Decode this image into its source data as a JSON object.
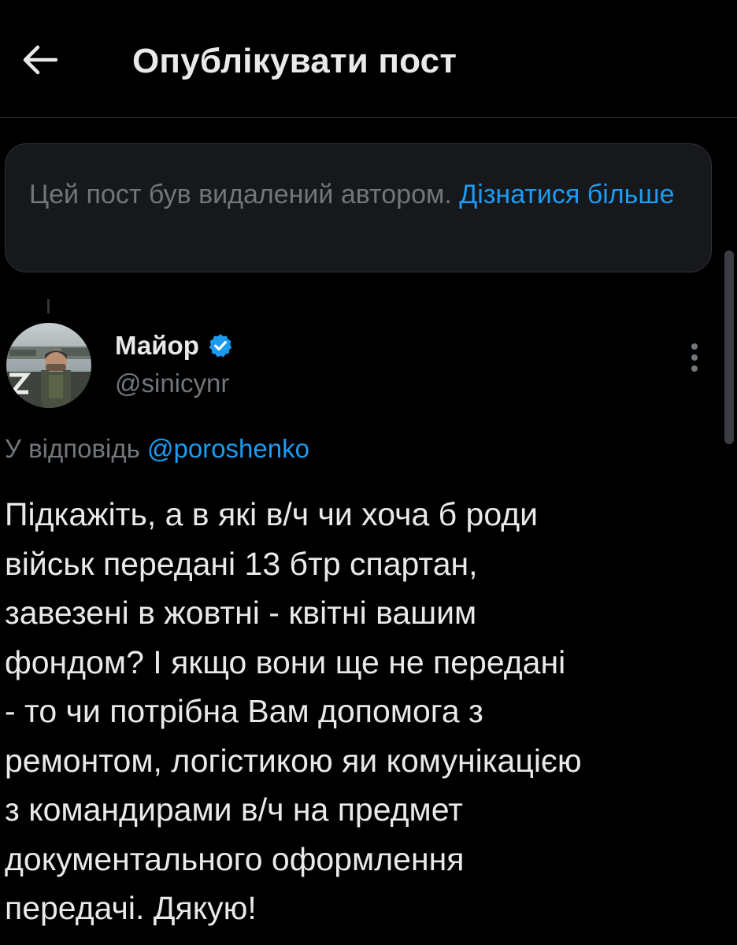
{
  "header": {
    "title": "Опублікувати пост",
    "back_icon": "arrow-left-icon"
  },
  "deleted_notice": {
    "text": "Цей пост був видалений автором.",
    "link_label": "Дізнатися більше"
  },
  "tweet": {
    "author": {
      "display_name": "Майор",
      "handle": "@sinicynr",
      "verified": true,
      "avatar_icon": "profile-photo"
    },
    "reply_to_prefix": "У відповідь",
    "reply_to_handle": "@poroshenko",
    "text_lines": [
      "Підкажіть, а в які в/ч чи хоча б роди",
      "військ передані 13 бтр спартан,",
      "завезені в жовтні - квітні вашим",
      "фондом? І якщо вони ще не передані",
      "- то чи потрібна Вам допомога з",
      "ремонтом, логістикою яи комунікацією",
      "з командирами в/ч на предмет",
      "документального оформлення",
      "передачі. Дякую!"
    ]
  },
  "colors": {
    "background": "#000000",
    "primary_text": "#e7e9ea",
    "secondary_text": "#71767b",
    "link": "#1d9bf0",
    "card_background": "#16181c",
    "border": "#2f3336"
  }
}
